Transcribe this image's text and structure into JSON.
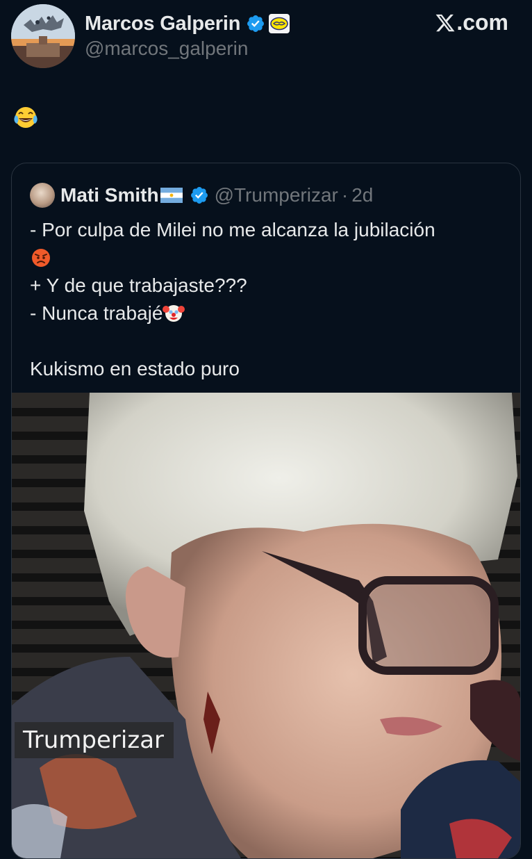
{
  "author": {
    "display_name": "Marcos Galperin",
    "handle": "@marcos_galperin"
  },
  "site_label": ".com",
  "site_logo_icon": "x-logo-icon",
  "tweet": {
    "emoji_icon": "face-with-tears-of-joy-icon"
  },
  "quoted_tweet": {
    "display_name": "Mati Smith",
    "flag_icon": "argentina-flag-icon",
    "handle": "@Trumperizar",
    "separator": "·",
    "time": "2d",
    "lines": [
      "- Por culpa de Milei no me alcanza la jubilación",
      "+ Y de que trabajaste???",
      "- Nunca trabajé",
      "Kukismo en estado puro"
    ],
    "inline_emoji_icons": [
      "angry-face-icon",
      "clown-face-icon"
    ],
    "media": {
      "watermark": "Trumperizar"
    }
  },
  "colors": {
    "background": "#06101c",
    "text_primary": "#e7e9ea",
    "text_secondary": "#71767b",
    "verified_blue": "#1d9bf0",
    "card_border": "#2a3440"
  }
}
